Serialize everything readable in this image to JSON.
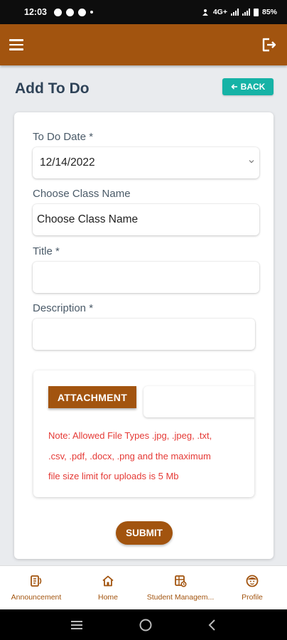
{
  "status_bar": {
    "time": "12:03",
    "network": "4G+",
    "battery": "85%"
  },
  "app_bar": {
    "menu_icon": "hamburger-menu-icon",
    "logout_icon": "logout-icon"
  },
  "page": {
    "title": "Add To Do",
    "back_label": "BACK"
  },
  "form": {
    "todo_date_label": "To Do Date *",
    "todo_date_value": "12/14/2022",
    "class_label": "Choose Class Name",
    "class_value": "Choose Class Name",
    "title_label": "Title *",
    "title_value": "",
    "description_label": "Description *",
    "description_value": "",
    "attachment_label": "ATTACHMENT",
    "file_value": "",
    "note_lines": [
      "Note: Allowed File Types .jpg, .jpeg, .txt,",
      ".csv, .pdf, .docx, .png and the maximum",
      "file size limit for uploads is 5 Mb"
    ],
    "submit_label": "SUBMIT"
  },
  "bottom_nav": {
    "items": [
      {
        "label": "Announcement",
        "icon": "announcement-icon"
      },
      {
        "label": "Home",
        "icon": "home-icon"
      },
      {
        "label": "Student Managem...",
        "icon": "student-management-icon"
      },
      {
        "label": "Profile",
        "icon": "profile-icon"
      }
    ]
  },
  "colors": {
    "brand": "#a2540f",
    "accent": "#16b3a6",
    "warning_text": "#e53935",
    "title_text": "#2f4358"
  }
}
